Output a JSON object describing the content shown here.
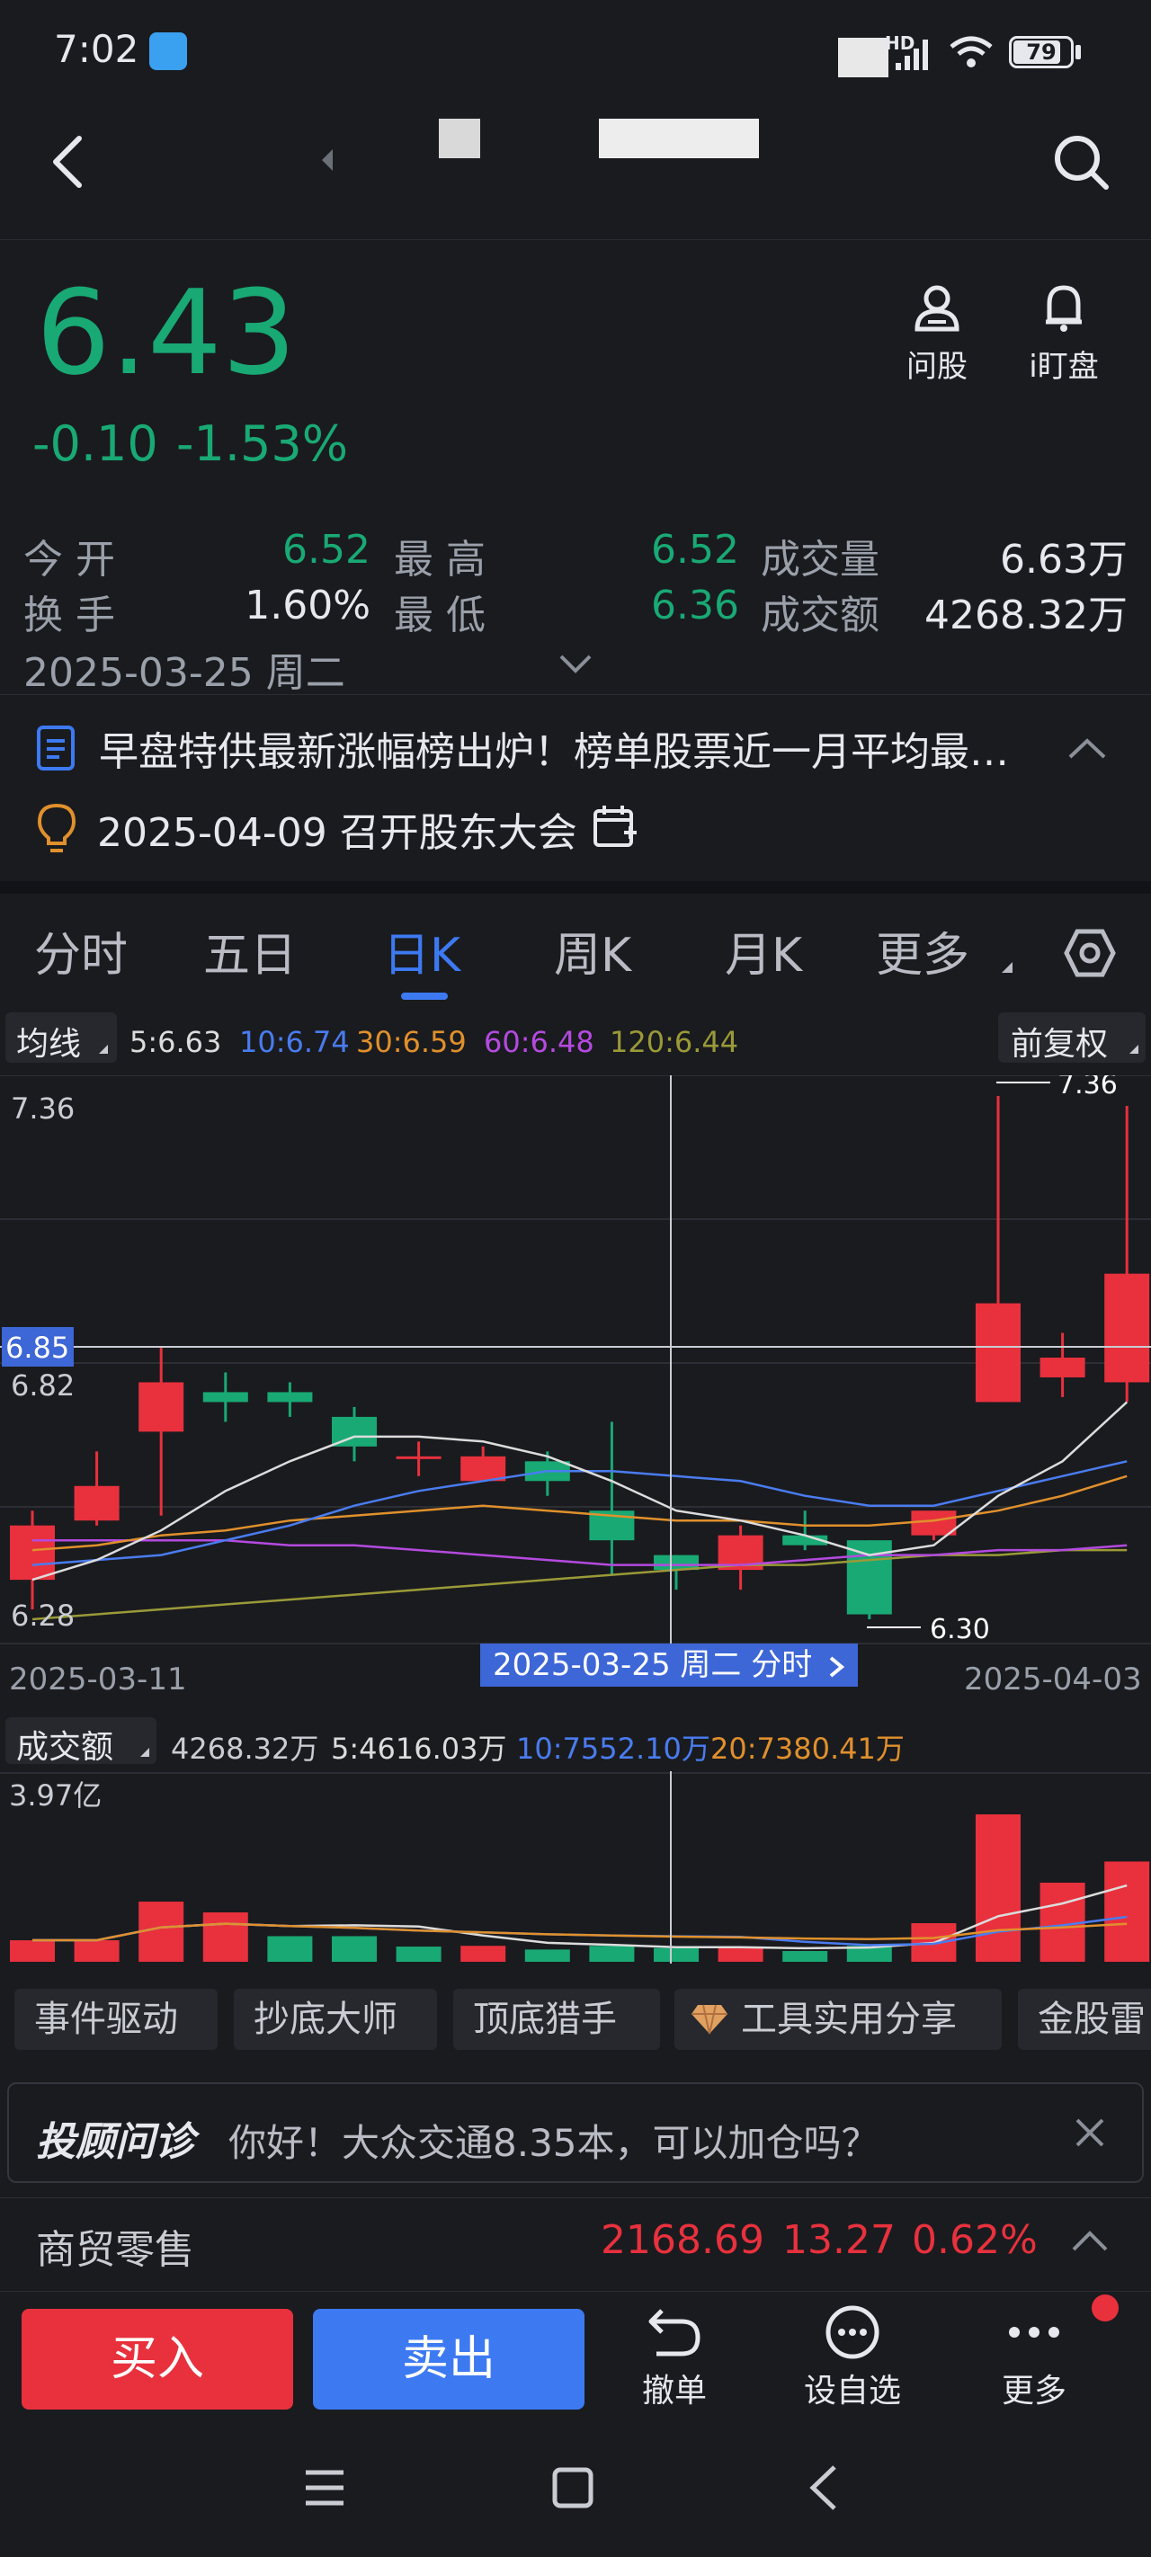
{
  "status_bar": {
    "time": "7:02",
    "signal": "HD",
    "battery": "79"
  },
  "header": {
    "back_icon": "chevron-left-icon",
    "search_icon": "search-icon"
  },
  "quote": {
    "price": "6.43",
    "change": "-0.10",
    "change_pct": "-1.53%",
    "actions": [
      {
        "icon": "person-icon",
        "label": "问股"
      },
      {
        "icon": "bell-icon",
        "label": "i盯盘"
      }
    ],
    "stats": {
      "open_label": "今  开",
      "open": "6.52",
      "high_label": "最  高",
      "high": "6.52",
      "volume_label": "成交量",
      "volume": "6.63万",
      "turnover_label": "换  手",
      "turnover": "1.60%",
      "low_label": "最  低",
      "low": "6.36",
      "amount_label": "成交额",
      "amount": "4268.32万"
    },
    "date": "2025-03-25 周二"
  },
  "news": {
    "text": "早盘特供最新涨幅榜出炉！榜单股票近一月平均最…"
  },
  "event": {
    "text": "2025-04-09 召开股东大会"
  },
  "tabs": [
    {
      "label": "分时"
    },
    {
      "label": "五日"
    },
    {
      "label": "日K"
    },
    {
      "label": "周K"
    },
    {
      "label": "月K"
    },
    {
      "label": "更多"
    }
  ],
  "ma_bar": {
    "label": "均线",
    "ma5": "5:6.63",
    "ma10": "10:6.74",
    "ma30": "30:6.59",
    "ma60": "60:6.48",
    "ma120": "120:6.44",
    "adjust": "前复权"
  },
  "chart_data": {
    "type": "candlestick",
    "y_axis_labels": [
      "7.36",
      "6.85",
      "6.82",
      "6.28"
    ],
    "annotations": {
      "high": "7.36",
      "low": "6.30",
      "crosshair_price": "6.85"
    },
    "x_start": "2025-03-11",
    "x_end": "2025-04-03",
    "crosshair_label": "2025-03-25 周二 分时",
    "colors": {
      "up": "#e8313d",
      "down": "#19a974",
      "ma5": "#dcdcdc",
      "ma10": "#4a7cf0",
      "ma30": "#e0902c",
      "ma60": "#b44adf",
      "ma120": "#9a9a38"
    },
    "candles": [
      {
        "o": 6.38,
        "h": 6.52,
        "l": 6.32,
        "c": 6.49
      },
      {
        "o": 6.5,
        "h": 6.64,
        "l": 6.49,
        "c": 6.57
      },
      {
        "o": 6.68,
        "h": 6.85,
        "l": 6.51,
        "c": 6.78
      },
      {
        "o": 6.76,
        "h": 6.8,
        "l": 6.7,
        "c": 6.74
      },
      {
        "o": 6.76,
        "h": 6.78,
        "l": 6.71,
        "c": 6.74
      },
      {
        "o": 6.71,
        "h": 6.73,
        "l": 6.62,
        "c": 6.65
      },
      {
        "o": 6.63,
        "h": 6.66,
        "l": 6.59,
        "c": 6.63
      },
      {
        "o": 6.58,
        "h": 6.65,
        "l": 6.58,
        "c": 6.63
      },
      {
        "o": 6.62,
        "h": 6.64,
        "l": 6.55,
        "c": 6.58
      },
      {
        "o": 6.52,
        "h": 6.7,
        "l": 6.39,
        "c": 6.46
      },
      {
        "o": 6.43,
        "h": 6.43,
        "l": 6.36,
        "c": 6.4
      },
      {
        "o": 6.4,
        "h": 6.49,
        "l": 6.36,
        "c": 6.47
      },
      {
        "o": 6.47,
        "h": 6.52,
        "l": 6.44,
        "c": 6.45
      },
      {
        "o": 6.46,
        "h": 6.46,
        "l": 6.3,
        "c": 6.31
      },
      {
        "o": 6.47,
        "h": 6.52,
        "l": 6.46,
        "c": 6.52
      },
      {
        "o": 6.74,
        "h": 7.36,
        "l": 6.74,
        "c": 6.94
      },
      {
        "o": 6.79,
        "h": 6.88,
        "l": 6.75,
        "c": 6.83
      },
      {
        "o": 6.78,
        "h": 7.34,
        "l": 6.74,
        "c": 7.0
      }
    ],
    "ma5": [
      6.38,
      6.42,
      6.48,
      6.56,
      6.62,
      6.67,
      6.67,
      6.66,
      6.63,
      6.58,
      6.52,
      6.5,
      6.47,
      6.43,
      6.45,
      6.55,
      6.62,
      6.74
    ],
    "ma10": [
      6.41,
      6.42,
      6.43,
      6.46,
      6.49,
      6.53,
      6.56,
      6.58,
      6.6,
      6.6,
      6.59,
      6.58,
      6.55,
      6.53,
      6.53,
      6.56,
      6.59,
      6.62
    ],
    "ma30": [
      6.44,
      6.45,
      6.47,
      6.48,
      6.5,
      6.51,
      6.52,
      6.53,
      6.52,
      6.51,
      6.5,
      6.5,
      6.49,
      6.49,
      6.5,
      6.52,
      6.55,
      6.59
    ],
    "ma60": [
      6.46,
      6.46,
      6.46,
      6.46,
      6.45,
      6.45,
      6.44,
      6.43,
      6.42,
      6.41,
      6.41,
      6.41,
      6.42,
      6.43,
      6.43,
      6.44,
      6.44,
      6.45
    ],
    "ma120": [
      6.3,
      6.31,
      6.32,
      6.33,
      6.34,
      6.35,
      6.36,
      6.37,
      6.38,
      6.39,
      6.4,
      6.41,
      6.41,
      6.42,
      6.43,
      6.43,
      6.44,
      6.44
    ]
  },
  "volume_bar": {
    "label": "成交额",
    "total": "4268.32万",
    "ma5": "5:4616.03万",
    "ma10": "10:7552.10万",
    "ma20": "20:7380.41万",
    "max_label": "3.97亿"
  },
  "volume_data": {
    "values_yi": [
      0.58,
      0.58,
      1.62,
      1.33,
      0.69,
      0.69,
      0.41,
      0.43,
      0.33,
      0.43,
      0.37,
      0.41,
      0.29,
      0.43,
      1.04,
      3.97,
      2.13,
      2.7
    ],
    "up": [
      true,
      true,
      true,
      true,
      false,
      false,
      false,
      true,
      false,
      false,
      false,
      true,
      false,
      false,
      true,
      true,
      true,
      true
    ]
  },
  "chips": [
    {
      "label": "事件驱动"
    },
    {
      "label": "抄底大师"
    },
    {
      "label": "顶底猎手"
    },
    {
      "label": "工具实用分享"
    },
    {
      "label": "金股雷"
    }
  ],
  "advisor": {
    "brand": "投顾问诊",
    "message": "你好！大众交通8.35本，可以加仓吗？"
  },
  "sector": {
    "name": "商贸零售",
    "value": "2168.69",
    "change": "13.27",
    "pct": "0.62%"
  },
  "bottom": {
    "buy": "买入",
    "sell": "卖出",
    "actions": [
      {
        "label": "撤单"
      },
      {
        "label": "设自选"
      },
      {
        "label": "更多"
      }
    ]
  }
}
